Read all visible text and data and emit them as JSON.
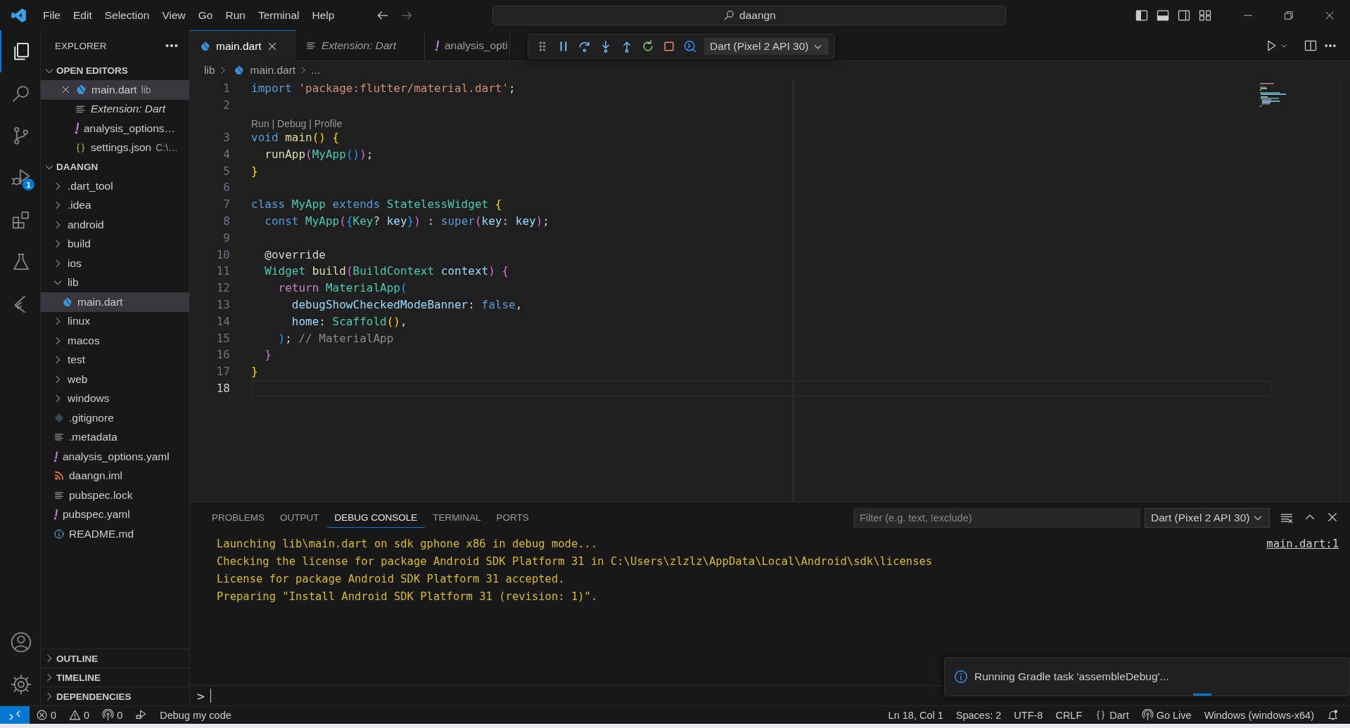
{
  "menu": [
    "File",
    "Edit",
    "Selection",
    "View",
    "Go",
    "Run",
    "Terminal",
    "Help"
  ],
  "command_center": {
    "text": "daangn"
  },
  "activity_bar": [
    {
      "kind": "files",
      "selected": true
    },
    {
      "kind": "search",
      "selected": false
    },
    {
      "kind": "branch",
      "selected": false
    },
    {
      "kind": "debug",
      "selected": false,
      "badge": "1"
    },
    {
      "kind": "blocks",
      "selected": false
    },
    {
      "kind": "flask",
      "selected": false
    },
    {
      "kind": "angle",
      "selected": false
    }
  ],
  "activity_bar_bottom": [
    {
      "kind": "user"
    },
    {
      "kind": "gear"
    }
  ],
  "sidebar": {
    "title": "EXPLORER",
    "open_editors": {
      "title": "OPEN EDITORS",
      "expanded": true,
      "items": [
        {
          "label": "main.dart",
          "description": "lib",
          "kind": "dart",
          "selected": true,
          "preview": false
        },
        {
          "label": "Extension: Dart",
          "kind": "lines",
          "selected": false,
          "preview": true
        },
        {
          "label": "analysis_options…",
          "kind": "yaml",
          "selected": false,
          "preview": false
        },
        {
          "label": "settings.json",
          "description": "C:\\…",
          "kind": "json",
          "selected": false,
          "preview": false
        }
      ]
    },
    "project": {
      "title": "DAANGN",
      "expanded": true,
      "items": [
        {
          "label": ".dart_tool",
          "kind": "folder",
          "expanded": false,
          "selected": false
        },
        {
          "label": ".idea",
          "kind": "folder",
          "expanded": false,
          "selected": false
        },
        {
          "label": "android",
          "kind": "folder",
          "expanded": false,
          "selected": false
        },
        {
          "label": "build",
          "kind": "folder",
          "expanded": false,
          "selected": false
        },
        {
          "label": "ios",
          "kind": "folder",
          "expanded": false,
          "selected": false
        },
        {
          "label": "lib",
          "kind": "folder",
          "expanded": true,
          "selected": false,
          "children": [
            {
              "label": "main.dart",
              "kind": "dart",
              "selected": true
            }
          ]
        },
        {
          "label": "linux",
          "kind": "folder",
          "expanded": false,
          "selected": false
        },
        {
          "label": "macos",
          "kind": "folder",
          "expanded": false,
          "selected": false
        },
        {
          "label": "test",
          "kind": "folder",
          "expanded": false,
          "selected": false
        },
        {
          "label": "web",
          "kind": "folder",
          "expanded": false,
          "selected": false
        },
        {
          "label": "windows",
          "kind": "folder",
          "expanded": false,
          "selected": false
        },
        {
          "label": ".gitignore",
          "kind": "git",
          "selected": false
        },
        {
          "label": ".metadata",
          "kind": "lines",
          "selected": false
        },
        {
          "label": "analysis_options.yaml",
          "kind": "yaml",
          "selected": false
        },
        {
          "label": "daangn.iml",
          "kind": "rss",
          "selected": false
        },
        {
          "label": "pubspec.lock",
          "kind": "lines",
          "selected": false
        },
        {
          "label": "pubspec.yaml",
          "kind": "yaml",
          "selected": false
        },
        {
          "label": "README.md",
          "kind": "info",
          "selected": false
        }
      ]
    },
    "bottom_sections": [
      {
        "title": "OUTLINE",
        "expanded": false
      },
      {
        "title": "TIMELINE",
        "expanded": false
      },
      {
        "title": "DEPENDENCIES",
        "expanded": false
      }
    ]
  },
  "tabs": [
    {
      "label": "main.dart",
      "kind": "dart",
      "selected": true,
      "preview": false
    },
    {
      "label": "Extension: Dart",
      "kind": "lines",
      "selected": false,
      "preview": true
    },
    {
      "label": "analysis_opti",
      "kind": "yaml",
      "selected": false,
      "preview": false
    }
  ],
  "debug_toolbar": {
    "target": "Dart (Pixel 2 API 30)"
  },
  "breadcrumb": [
    "lib",
    "main.dart",
    "..."
  ],
  "code": [
    {
      "number": "1",
      "tokens": [
        {
          "text": "import ",
          "kind": "k"
        },
        {
          "text": "'package:flutter/material.dart'",
          "kind": "s"
        },
        {
          "text": ";",
          "kind": "p"
        }
      ]
    },
    {
      "number": "2"
    },
    {
      "number": "3",
      "code_lens": "Run | Debug | Profile",
      "tokens": [
        {
          "text": "void ",
          "kind": "k"
        },
        {
          "text": "main",
          "kind": "f"
        },
        {
          "text": "() {",
          "kind": "b1"
        }
      ]
    },
    {
      "number": "4",
      "tokens": [
        {
          "text": "  runApp",
          "kind": "f"
        },
        {
          "text": "(",
          "kind": "b2"
        },
        {
          "text": "MyApp",
          "kind": "t"
        },
        {
          "text": "()",
          "kind": "b3"
        },
        {
          "text": ")",
          "kind": "b2"
        },
        {
          "text": ";",
          "kind": "p"
        }
      ]
    },
    {
      "number": "5",
      "tokens": [
        {
          "text": "}",
          "kind": "b1"
        }
      ]
    },
    {
      "number": "6"
    },
    {
      "number": "7",
      "tokens": [
        {
          "text": "class ",
          "kind": "k"
        },
        {
          "text": "MyApp ",
          "kind": "t"
        },
        {
          "text": "extends ",
          "kind": "k"
        },
        {
          "text": "StatelessWidget ",
          "kind": "t"
        },
        {
          "text": "{",
          "kind": "b1"
        }
      ]
    },
    {
      "number": "8",
      "tokens": [
        {
          "text": "  const ",
          "kind": "k"
        },
        {
          "text": "MyApp",
          "kind": "t"
        },
        {
          "text": "(",
          "kind": "b2"
        },
        {
          "text": "{",
          "kind": "b3"
        },
        {
          "text": "Key",
          "kind": "t"
        },
        {
          "text": "? ",
          "kind": "p"
        },
        {
          "text": "key",
          "kind": "v"
        },
        {
          "text": "}",
          "kind": "b3"
        },
        {
          "text": ")",
          "kind": "b2"
        },
        {
          "text": " : ",
          "kind": "p"
        },
        {
          "text": "super",
          "kind": "k"
        },
        {
          "text": "(",
          "kind": "b2"
        },
        {
          "text": "key",
          "kind": "v"
        },
        {
          "text": ": ",
          "kind": "p"
        },
        {
          "text": "key",
          "kind": "v"
        },
        {
          "text": ")",
          "kind": "b2"
        },
        {
          "text": ";",
          "kind": "p"
        }
      ]
    },
    {
      "number": "9"
    },
    {
      "number": "10",
      "tokens": [
        {
          "text": "  @override",
          "kind": "p"
        }
      ]
    },
    {
      "number": "11",
      "tokens": [
        {
          "text": "  Widget ",
          "kind": "t"
        },
        {
          "text": "build",
          "kind": "f"
        },
        {
          "text": "(",
          "kind": "b2"
        },
        {
          "text": "BuildContext ",
          "kind": "t"
        },
        {
          "text": "context",
          "kind": "v"
        },
        {
          "text": ")",
          "kind": "b2"
        },
        {
          "text": " {",
          "kind": "b2"
        }
      ]
    },
    {
      "number": "12",
      "tokens": [
        {
          "text": "    return ",
          "kind": "c"
        },
        {
          "text": "MaterialApp",
          "kind": "t"
        },
        {
          "text": "(",
          "kind": "b3"
        }
      ]
    },
    {
      "number": "13",
      "tokens": [
        {
          "text": "      debugShowCheckedModeBanner",
          "kind": "v"
        },
        {
          "text": ": ",
          "kind": "p"
        },
        {
          "text": "false",
          "kind": "k"
        },
        {
          "text": ",",
          "kind": "p"
        }
      ]
    },
    {
      "number": "14",
      "tokens": [
        {
          "text": "      home",
          "kind": "v"
        },
        {
          "text": ": ",
          "kind": "p"
        },
        {
          "text": "Scaffold",
          "kind": "t"
        },
        {
          "text": "()",
          "kind": "b1"
        },
        {
          "text": ",",
          "kind": "p"
        }
      ]
    },
    {
      "number": "15",
      "tokens": [
        {
          "text": "    )",
          "kind": "b3"
        },
        {
          "text": "; ",
          "kind": "p"
        },
        {
          "text": "// MaterialApp",
          "kind": "m"
        }
      ]
    },
    {
      "number": "16",
      "tokens": [
        {
          "text": "  }",
          "kind": "b2"
        }
      ]
    },
    {
      "number": "17",
      "tokens": [
        {
          "text": "}",
          "kind": "b1"
        }
      ]
    },
    {
      "number": "18",
      "current": true
    }
  ],
  "panel": {
    "tabs": [
      {
        "label": "PROBLEMS",
        "selected": false
      },
      {
        "label": "OUTPUT",
        "selected": false
      },
      {
        "label": "DEBUG CONSOLE",
        "selected": true
      },
      {
        "label": "TERMINAL",
        "selected": false
      },
      {
        "label": "PORTS",
        "selected": false
      }
    ],
    "filter": {
      "placeholder": "Filter (e.g. text, !exclude)"
    },
    "session": "Dart (Pixel 2 API 30)",
    "source_link": "main.dart:1",
    "lines": [
      "Launching lib\\main.dart on sdk gphone x86 in debug mode...",
      "Checking the license for package Android SDK Platform 31 in C:\\Users\\zlzlz\\AppData\\Local\\Android\\sdk\\licenses",
      "License for package Android SDK Platform 31 accepted.",
      "Preparing \"Install Android SDK Platform 31 (revision: 1)\"."
    ],
    "prompt": ">"
  },
  "notification": {
    "text": "Running Gradle task 'assembleDebug'..."
  },
  "status_bar": {
    "left": [
      {
        "kind": "remote"
      },
      {
        "kind": "error",
        "text": "0"
      },
      {
        "kind": "warning",
        "text": "0"
      },
      {
        "kind": "broadcast",
        "text": "0"
      },
      {
        "kind": "debug",
        "text": "Debug my code"
      }
    ],
    "right": [
      {
        "text": "Ln 18, Col 1"
      },
      {
        "text": "Spaces: 2"
      },
      {
        "text": "UTF-8"
      },
      {
        "text": "CRLF"
      },
      {
        "kind": "braces",
        "text": "Dart"
      },
      {
        "kind": "broadcast",
        "text": "Go Live"
      },
      {
        "text": "Windows (windows-x64)"
      },
      {
        "kind": "bell"
      }
    ]
  }
}
